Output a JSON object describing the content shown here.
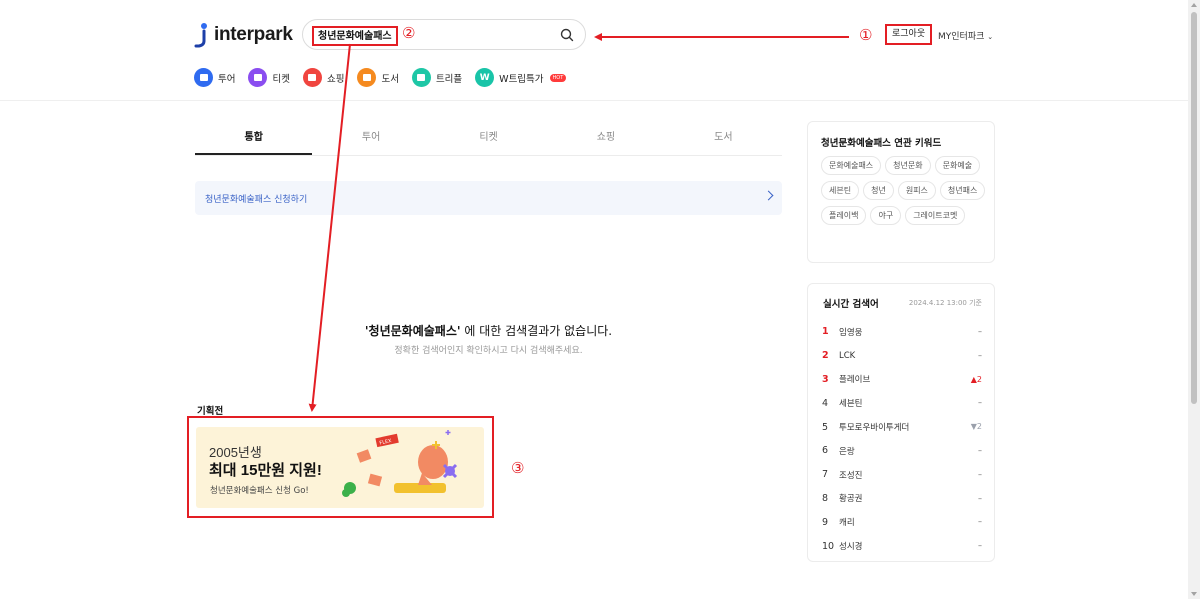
{
  "header": {
    "logo_text": "interpark",
    "search_value": "청년문화예술패스",
    "login_label": "로그아웃",
    "my_label": "MY인터파크"
  },
  "nav": [
    {
      "label": "투어",
      "icon": "tour-icon",
      "color": "#2f6bf0"
    },
    {
      "label": "티켓",
      "icon": "ticket-icon",
      "color": "#8a4df0"
    },
    {
      "label": "쇼핑",
      "icon": "shopping-icon",
      "color": "#f0453f"
    },
    {
      "label": "도서",
      "icon": "book-icon",
      "color": "#f58a1f"
    },
    {
      "label": "트리플",
      "icon": "triple-icon",
      "color": "#1ec7a6"
    },
    {
      "label": "W트립특가",
      "icon": "wtrip-icon",
      "color": "#19c4a8",
      "badge": "HOT"
    }
  ],
  "annotations": {
    "one": "①",
    "two": "②",
    "three": "③"
  },
  "tabs": [
    "통합",
    "투어",
    "티켓",
    "쇼핑",
    "도서"
  ],
  "apply_banner": "청년문화예술패스 신청하기",
  "no_result": {
    "keyword": "'청년문화예술패스'",
    "message": " 에 대한 검색결과가 없습니다.",
    "sub": "정확한 검색어인지 확인하시고 다시 검색해주세요."
  },
  "exhibition": {
    "title": "기획전",
    "line1": "2005년생",
    "line2": "최대 15만원 지원!",
    "line3": "청년문화예술패스 신청 Go!",
    "badge": "FLEX"
  },
  "related_keywords": {
    "title": "청년문화예술패스 연관 키워드",
    "tags": [
      "문화예술패스",
      "청년문화",
      "문화예술",
      "세븐틴",
      "청년",
      "원피스",
      "청년패스",
      "플레이백",
      "야구",
      "그레이트코멧"
    ]
  },
  "realtime": {
    "title": "실시간 검색어",
    "time": "2024.4.12 13:00 기준",
    "items": [
      {
        "rank": "1",
        "name": "임영웅",
        "trend": "–",
        "dir": "same"
      },
      {
        "rank": "2",
        "name": "LCK",
        "trend": "–",
        "dir": "same"
      },
      {
        "rank": "3",
        "name": "플레이브",
        "trend": "▲2",
        "dir": "up"
      },
      {
        "rank": "4",
        "name": "세븐틴",
        "trend": "–",
        "dir": "same"
      },
      {
        "rank": "5",
        "name": "투모로우바이투게더",
        "trend": "▼2",
        "dir": "down"
      },
      {
        "rank": "6",
        "name": "은랑",
        "trend": "–",
        "dir": "same"
      },
      {
        "rank": "7",
        "name": "조성진",
        "trend": "–",
        "dir": "same"
      },
      {
        "rank": "8",
        "name": "황공권",
        "trend": "–",
        "dir": "same"
      },
      {
        "rank": "9",
        "name": "캐리",
        "trend": "–",
        "dir": "same"
      },
      {
        "rank": "10",
        "name": "성시경",
        "trend": "–",
        "dir": "same"
      }
    ]
  }
}
